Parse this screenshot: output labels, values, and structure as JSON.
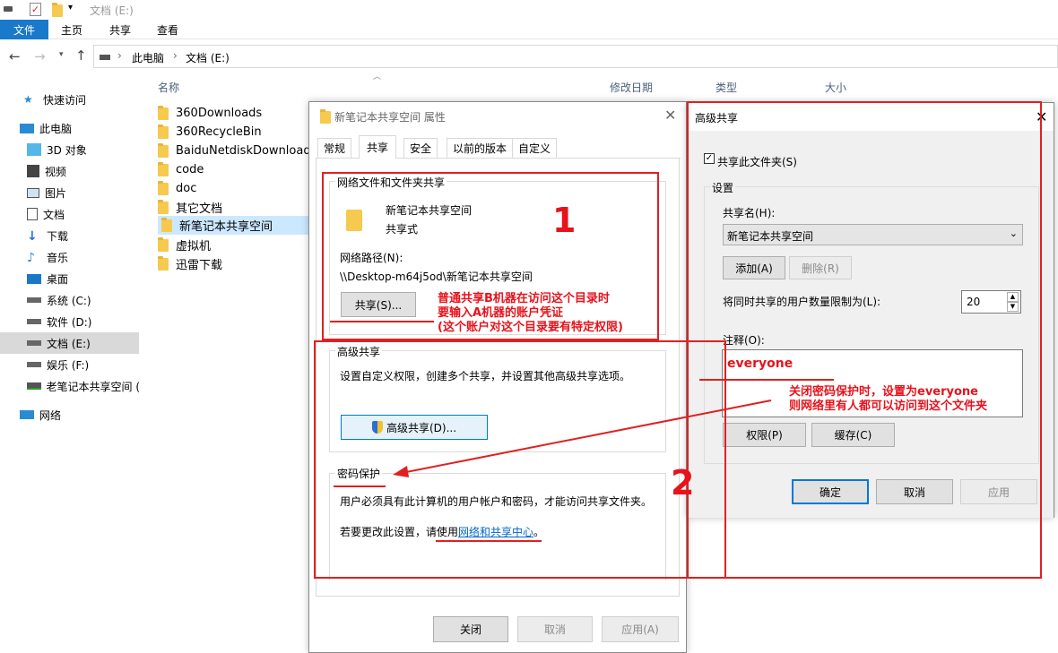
{
  "window": {
    "title": "文档 (E:)"
  },
  "ribbon": {
    "tabs": [
      "文件",
      "主页",
      "共享",
      "查看"
    ]
  },
  "address": {
    "crumbs": [
      "此电脑",
      "文档 (E:)"
    ]
  },
  "columns": {
    "name": "名称",
    "modified": "修改日期",
    "type": "类型",
    "size": "大小"
  },
  "sidebar": {
    "items": [
      {
        "label": "快速访问",
        "icon": "star-icon"
      },
      {
        "label": "此电脑",
        "icon": "computer-icon"
      },
      {
        "label": "3D 对象",
        "icon": "cube-icon"
      },
      {
        "label": "视频",
        "icon": "video-icon"
      },
      {
        "label": "图片",
        "icon": "picture-icon"
      },
      {
        "label": "文档",
        "icon": "document-icon"
      },
      {
        "label": "下载",
        "icon": "download-icon"
      },
      {
        "label": "音乐",
        "icon": "music-icon"
      },
      {
        "label": "桌面",
        "icon": "desktop-icon"
      },
      {
        "label": "系统 (C:)",
        "icon": "drive-icon"
      },
      {
        "label": "软件 (D:)",
        "icon": "drive-icon"
      },
      {
        "label": "文档 (E:)",
        "icon": "drive-icon"
      },
      {
        "label": "娱乐 (F:)",
        "icon": "drive-icon"
      },
      {
        "label": "老笔记本共享空间 (",
        "icon": "network-drive-icon"
      },
      {
        "label": "网络",
        "icon": "network-icon"
      }
    ]
  },
  "files": [
    "360Downloads",
    "360RecycleBin",
    "BaiduNetdiskDownload",
    "code",
    "doc",
    "其它文档",
    "新笔记本共享空间",
    "虚拟机",
    "迅雷下载"
  ],
  "props": {
    "title": "新笔记本共享空间 属性",
    "tabs": [
      "常规",
      "共享",
      "安全",
      "以前的版本",
      "自定义"
    ],
    "net_group": "网络文件和文件夹共享",
    "folder_name": "新笔记本共享空间",
    "folder_state": "共享式",
    "path_label": "网络路径(N):",
    "path_value": "\\\\Desktop-m64j5od\\新笔记本共享空间",
    "share_btn": "共享(S)...",
    "adv_group": "高级共享",
    "adv_desc": "设置自定义权限，创建多个共享，并设置其他高级共享选项。",
    "adv_btn": "高级共享(D)...",
    "pwd_group": "密码保护",
    "pwd_desc": "用户必须具有此计算机的用户帐户和密码，才能访问共享文件夹。",
    "pwd_change": "若要更改此设置，请使用",
    "pwd_link": "网络和共享中心",
    "pwd_end": "。",
    "close_btn": "关闭",
    "cancel_btn": "取消",
    "apply_btn": "应用(A)"
  },
  "adv": {
    "title": "高级共享",
    "share_check": "共享此文件夹(S)",
    "settings": "设置",
    "share_name_label": "共享名(H):",
    "share_name": "新笔记本共享空间",
    "add_btn": "添加(A)",
    "remove_btn": "删除(R)",
    "limit_label": "将同时共享的用户数量限制为(L):",
    "limit_value": "20",
    "comment_label": "注释(O):",
    "comment_value": "everyone",
    "perm_btn": "权限(P)",
    "cache_btn": "缓存(C)",
    "ok_btn": "确定",
    "cancel_btn": "取消",
    "apply_btn": "应用"
  },
  "annotations": {
    "num1": "1",
    "num2": "2",
    "note1": [
      "普通共享B机器在访问这个目录时",
      "要输入A机器的账户凭证",
      "(这个账户对这个目录要有特定权限)"
    ],
    "note2": [
      "关闭密码保护时，设置为everyone",
      "则网络里有人都可以访问到这个文件夹"
    ]
  },
  "colors": {
    "accent": "#0078d7",
    "annotation": "#e02020",
    "selected": "#cce8ff"
  }
}
